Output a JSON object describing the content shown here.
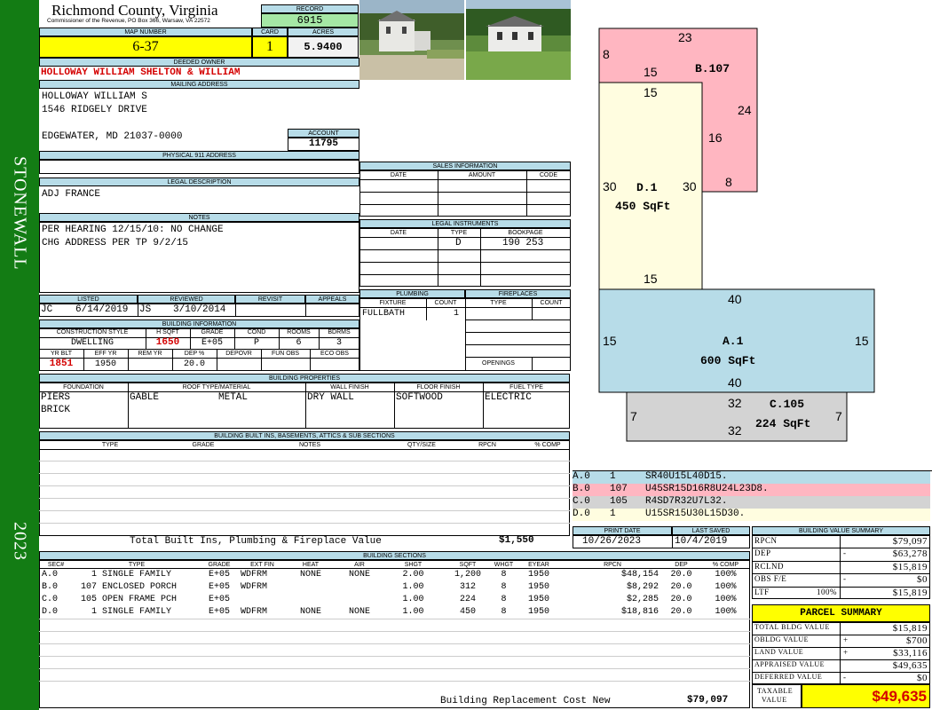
{
  "sidebar": {
    "district": "STONEWALL",
    "year": "2023"
  },
  "header": {
    "county": "Richmond County, Virginia",
    "address_line": "Commissioner of the Revenue, PO Box 366, Warsaw, VA 22572",
    "record_label": "RECORD",
    "record": "6915",
    "map_label": "MAP NUMBER",
    "map": "6-37",
    "card_label": "CARD",
    "card": "1",
    "acres_label": "ACRES",
    "acres": "5.9400"
  },
  "owner": {
    "label": "DEEDED OWNER",
    "name": "HOLLOWAY WILLIAM SHELTON & WILLIAM",
    "mailing_label": "MAILING ADDRESS",
    "line1": "HOLLOWAY WILLIAM S",
    "line2": "1546 RIDGELY DRIVE",
    "line3": "EDGEWATER, MD 21037-0000",
    "account_label": "ACCOUNT",
    "account": "11795"
  },
  "physical": {
    "label": "PHYSICAL 911 ADDRESS"
  },
  "legal": {
    "label": "LEGAL DESCRIPTION",
    "text": "ADJ FRANCE"
  },
  "notes": {
    "label": "NOTES",
    "line1": "PER HEARING 12/15/10: NO CHANGE",
    "line2": "CHG ADDRESS PER TP 9/2/15"
  },
  "sales": {
    "label": "SALES INFORMATION",
    "cols": [
      "DATE",
      "AMOUNT",
      "CODE"
    ]
  },
  "instruments": {
    "label": "LEGAL INSTRUMENTS",
    "cols": [
      "DATE",
      "TYPE",
      "BOOKPAGE"
    ],
    "type": "D",
    "bookpage": "190 253"
  },
  "listed": {
    "labels": [
      "LISTED",
      "REVIEWED",
      "REVISIT",
      "APPEALS"
    ],
    "lister": "JC",
    "listed_date": "6/14/2019",
    "reviewer": "JS",
    "reviewed_date": "3/10/2014"
  },
  "plumbing": {
    "label": "PLUMBING",
    "cols": [
      "FIXTURE",
      "COUNT"
    ],
    "fixture": "FULLBATH",
    "count": "1"
  },
  "fireplaces": {
    "label": "FIREPLACES",
    "cols": [
      "TYPE",
      "COUNT"
    ],
    "openings_label": "OPENINGS"
  },
  "building": {
    "label": "BUILDING INFORMATION",
    "cols1": [
      "CONSTRUCTION STYLE",
      "H SQFT",
      "GRADE",
      "COND",
      "ROOMS",
      "BDRMS"
    ],
    "style": "DWELLING",
    "hsqft": "1650",
    "grade": "E+05",
    "cond": "P",
    "rooms": "6",
    "bdrms": "3",
    "cols2": [
      "YR BLT",
      "EFF YR",
      "REM YR",
      "DEP %",
      "DEPOVR",
      "FUN OBS",
      "ECO OBS"
    ],
    "yrblt": "1851",
    "effyr": "1950",
    "dep": "20.0"
  },
  "properties": {
    "label": "BUILDING PROPERTIES",
    "cols": [
      "FOUNDATION",
      "ROOF TYPE/MATERIAL",
      "WALL FINISH",
      "FLOOR FINISH",
      "FUEL TYPE"
    ],
    "foundation1": "PIERS",
    "foundation2": "BRICK",
    "roof_type": "GABLE",
    "roof_material": "METAL",
    "wall": "DRY WALL",
    "floor": "SOFTWOOD",
    "fuel": "ELECTRIC"
  },
  "builtins": {
    "label": "BUILDING BUILT INS, BASEMENTS, ATTICS & SUB SECTIONS",
    "cols": [
      "TYPE",
      "GRADE",
      "NOTES",
      "QTY/SIZE",
      "RPCN",
      "% COMP"
    ],
    "total_label": "Total Built Ins, Plumbing & Fireplace Value",
    "total": "$1,550"
  },
  "sections": {
    "label": "BUILDING SECTIONS",
    "cols": [
      "SEC#",
      "TYPE",
      "GRADE",
      "EXT FIN",
      "HEAT",
      "AIR",
      "SHGT",
      "SQFT",
      "WHGT",
      "EYEAR",
      "RPCN",
      "DEP",
      "% COMP"
    ],
    "rows": [
      {
        "sec": "A.0",
        "type": "   1 SINGLE FAMILY",
        "grade": "E+05",
        "ext": "WDFRM",
        "heat": "NONE",
        "air": "NONE",
        "shgt": "2.00",
        "sqft": "1,200",
        "whgt": "8",
        "eyear": "1950",
        "rpcn": "$48,154",
        "dep": "20.0",
        "comp": "100%"
      },
      {
        "sec": "B.0",
        "type": " 107 ENCLOSED PORCH",
        "grade": "E+05",
        "ext": "WDFRM",
        "heat": "",
        "air": "",
        "shgt": "1.00",
        "sqft": "312",
        "whgt": "8",
        "eyear": "1950",
        "rpcn": "$8,292",
        "dep": "20.0",
        "comp": "100%"
      },
      {
        "sec": "C.0",
        "type": " 105 OPEN FRAME PCH",
        "grade": "E+05",
        "ext": "",
        "heat": "",
        "air": "",
        "shgt": "1.00",
        "sqft": "224",
        "whgt": "8",
        "eyear": "1950",
        "rpcn": "$2,285",
        "dep": "20.0",
        "comp": "100%"
      },
      {
        "sec": "D.0",
        "type": "   1 SINGLE FAMILY",
        "grade": "E+05",
        "ext": "WDFRM",
        "heat": "NONE",
        "air": "NONE",
        "shgt": "1.00",
        "sqft": "450",
        "whgt": "8",
        "eyear": "1950",
        "rpcn": "$18,816",
        "dep": "20.0",
        "comp": "100%"
      }
    ],
    "replacement_label": "Building Replacement Cost New",
    "replacement": "$79,097"
  },
  "sketch": {
    "b_top": "23",
    "b_left": "8",
    "b_bottom": "15",
    "b_label": "B.107",
    "b_right": "24",
    "b_inner": "16",
    "b_low": "8",
    "d_top": "15",
    "d_left": "30",
    "d_label": "D.1",
    "d_right": "30",
    "d_area": "450 SqFt",
    "d_bottom": "15",
    "a_top": "40",
    "a_left": "15",
    "a_label": "A.1",
    "a_right": "15",
    "a_area": "600 SqFt",
    "a_bottom": "40",
    "c_top": "32",
    "c_label": "C.105",
    "c_left": "7",
    "c_right": "7",
    "c_area": "224 SqFt",
    "c_bottom": "32"
  },
  "legend": [
    {
      "code": "A.0",
      "n": "1",
      "path": "SR40U15L40D15.",
      "color": "#b7dce8"
    },
    {
      "code": "B.0",
      "n": "107",
      "path": "U45SR15D16R8U24L23D8.",
      "color": "#ffb6c1"
    },
    {
      "code": "C.0",
      "n": "105",
      "path": "R4SD7R32U7L32.",
      "color": "#d3d3d3"
    },
    {
      "code": "D.0",
      "n": "1",
      "path": "U15SR15U30L15D30.",
      "color": "#fffde0"
    }
  ],
  "dates": {
    "print_label": "PRINT DATE",
    "print": "10/26/2023",
    "saved_label": "LAST SAVED",
    "saved": "10/4/2019"
  },
  "valuesummary": {
    "label": "BUILDING VALUE SUMMARY",
    "rows": [
      {
        "k": "RPCN",
        "s": "",
        "p": "",
        "v": "$79,097"
      },
      {
        "k": "DEP",
        "s": "",
        "p": "-",
        "v": "$63,278"
      },
      {
        "k": "RCLND",
        "s": "",
        "p": "",
        "v": "$15,819"
      },
      {
        "k": "OBS F/E",
        "s": "",
        "p": "-",
        "v": "$0"
      },
      {
        "k": "LTF",
        "s": "100%",
        "p": "",
        "v": "$15,819"
      }
    ]
  },
  "parcel": {
    "label": "PARCEL SUMMARY",
    "rows": [
      {
        "k": "TOTAL BLDG VALUE",
        "p": "",
        "v": "$15,819"
      },
      {
        "k": "OBLDG VALUE",
        "p": "+",
        "v": "$700"
      },
      {
        "k": "LAND VALUE",
        "p": "+",
        "v": "$33,116"
      },
      {
        "k": "APPRAISED VALUE",
        "p": "",
        "v": "$49,635"
      },
      {
        "k": "DEFERRED VALUE",
        "p": "-",
        "v": "$0"
      }
    ],
    "taxable_label1": "TAXABLE",
    "taxable_label2": "VALUE",
    "taxable": "$49,635"
  },
  "colors": {
    "green": "#137c14",
    "header_blue": "#b7dce8",
    "highlight": "#ffff00",
    "record_green": "#a5e7a5",
    "red": "#d40000"
  }
}
